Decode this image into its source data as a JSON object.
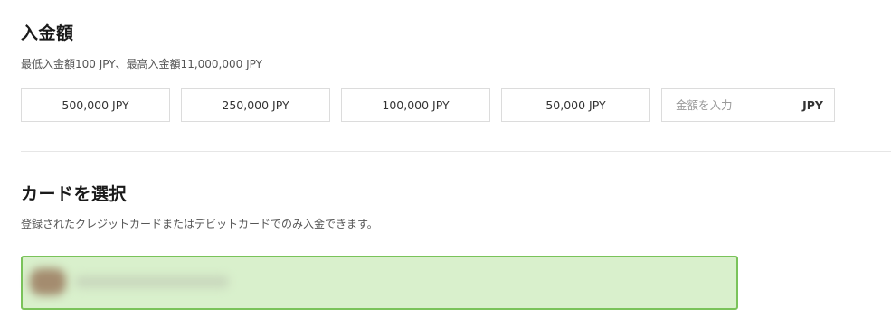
{
  "deposit": {
    "title": "入金額",
    "limits_text": "最低入金額100 JPY、最高入金額11,000,000 JPY",
    "presets": [
      "500,000 JPY",
      "250,000 JPY",
      "100,000 JPY",
      "50,000 JPY"
    ],
    "custom_input": {
      "placeholder": "金額を入力",
      "value": "",
      "currency": "JPY"
    }
  },
  "card": {
    "title": "カードを選択",
    "description": "登録されたクレジットカードまたはデビットカードでのみ入金できます。",
    "selected_card": {
      "status": "selected",
      "details_obscured": true,
      "highlight_color": "#d9f0cc",
      "border_color": "#7ac35a"
    }
  }
}
